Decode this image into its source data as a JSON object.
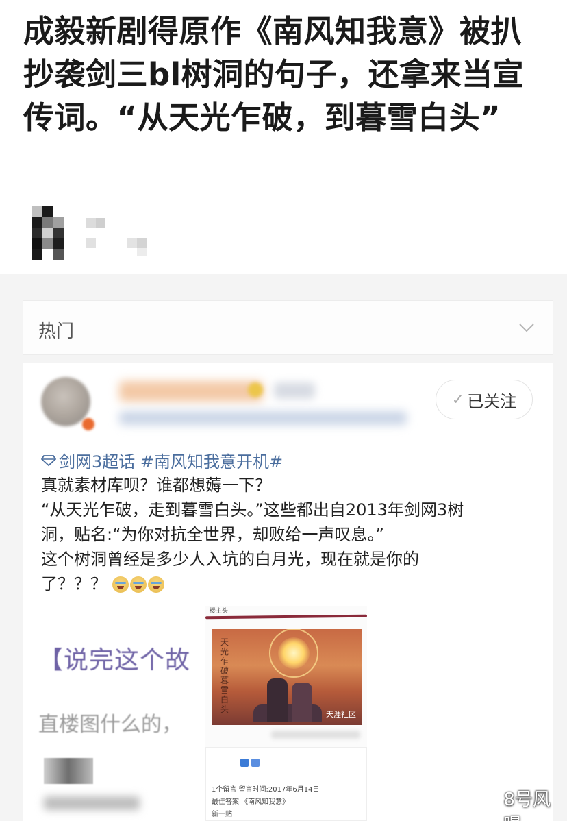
{
  "headline": "成毅新剧得原作《南风知我意》被扒抄袭剑三bl树洞的句子，还拿来当宣传词。“从天光乍破，到暮雪白头”",
  "hot_section": {
    "label": "热门",
    "icon": "chevron-down-icon"
  },
  "post": {
    "follow_label": "已关注",
    "topic": "剑网3超话 #南风知我意开机#",
    "lines": [
      "真就素材库呗？谁都想薅一下？",
      "“从天光乍破，走到暮雪白头。”这些都出自2013年剑网3树",
      "洞，贴名:“为你对抗全世界，却败给一声叹息。”",
      "这个树洞曾经是多少人入坑的白月光，现在就是你的",
      "了？？？"
    ],
    "image_text_1": "【说完这个故",
    "image_text_2": "直楼图什么的，",
    "poster": {
      "vertical_title": "天光乍破暮雪白头",
      "brand": "天涯社区",
      "label": "楼主头"
    },
    "screenshot_rows": [
      "1个留言  留言时间:2017年6月14日",
      "最佳答案  《南风知我意》",
      "新一贴"
    ]
  },
  "watermark": "8号风曝",
  "colors": {
    "topic_blue": "#4b6e9e",
    "red_underline": "#8a2a3a",
    "background_gray": "#f4f4f4"
  }
}
